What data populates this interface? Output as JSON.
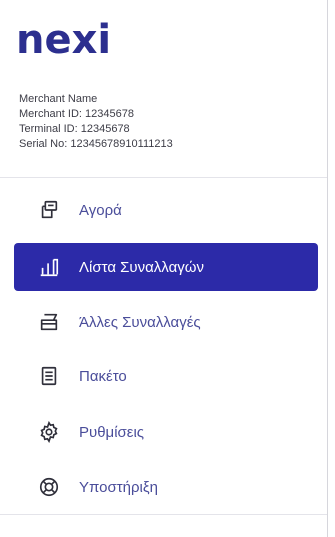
{
  "logo_text": "nexi",
  "merchant": {
    "name": "Merchant Name",
    "merchant_id": "Merchant ID: 12345678",
    "terminal_id": "Terminal ID: 12345678",
    "serial_no": "Serial No: 12345678910111213"
  },
  "menu": {
    "purchase": "Αγορά",
    "transactions_list": "Λίστα Συναλλαγών",
    "other_transactions": "Άλλες Συναλλαγές",
    "package": "Πακέτο",
    "settings": "Ρυθμίσεις",
    "support": "Υποστήριξη"
  },
  "active_item": "transactions_list",
  "colors": {
    "brand": "#2c2f8f",
    "active_bg": "#2c2aa8",
    "menu_text": "#4a4d9a"
  }
}
